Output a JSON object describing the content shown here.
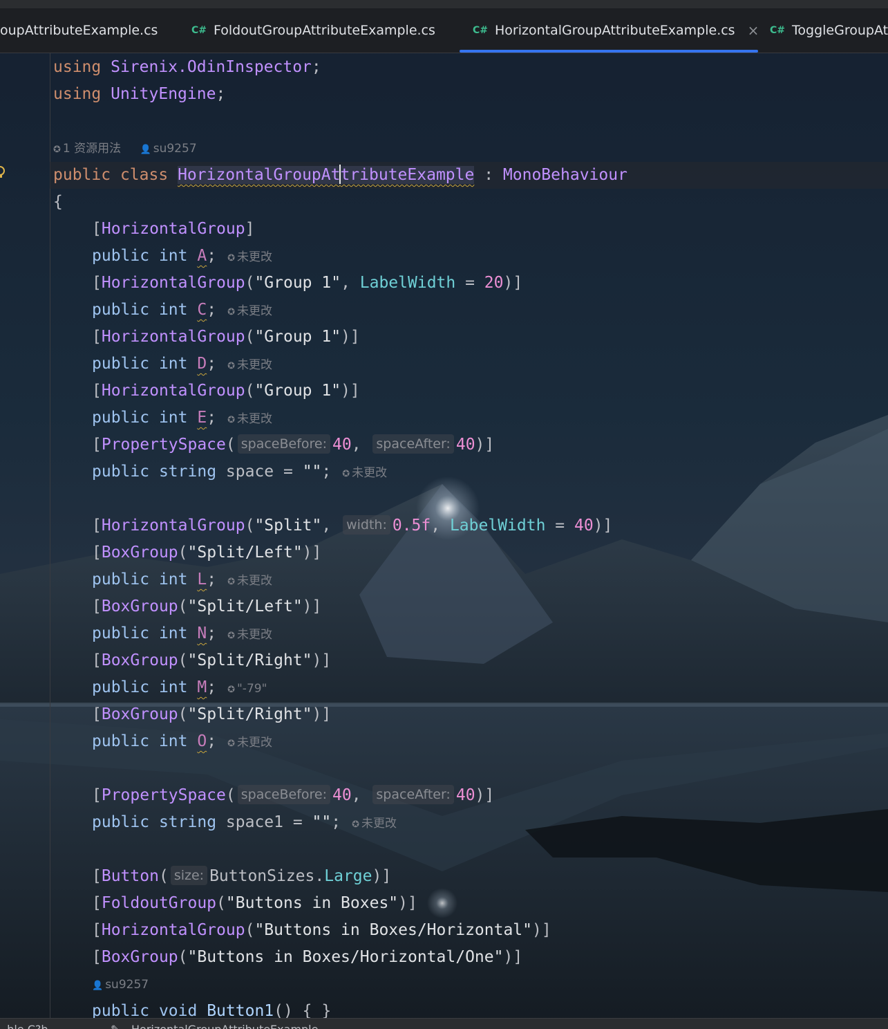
{
  "tabs": [
    {
      "label": "GroupAttributeExample.cs",
      "display": "oupAttributeExample.cs",
      "active": false
    },
    {
      "label": "FoldoutGroupAttributeExample.cs",
      "active": false
    },
    {
      "label": "HorizontalGroupAttributeExample.cs",
      "active": true
    },
    {
      "label": "ToggleGroupAt",
      "active": false
    }
  ],
  "tab_lang_badge": "C#",
  "tab_close_glyph": "×",
  "lens": {
    "usages": "1 资源用法",
    "author": "su9257",
    "unchanged": "未更改",
    "value_m": "\"-79\""
  },
  "code": {
    "using": "using",
    "ns1": "Sirenix.OdinInspector",
    "ns2": "UnityEngine",
    "public": "public",
    "class": "class",
    "int": "int",
    "string": "string",
    "void": "void",
    "class_name_a": "HorizontalGroupAt",
    "class_name_b": "tributeExample",
    "base": "MonoBehaviour",
    "open_brace": "{",
    "horizontal_group": "HorizontalGroup",
    "box_group": "BoxGroup",
    "property_space": "PropertySpace",
    "button": "Button",
    "foldout_group": "FoldoutGroup",
    "group1": "\"Group 1\"",
    "label_width": "LabelWidth",
    "split": "\"Split\"",
    "split_left": "\"Split/Left\"",
    "split_right": "\"Split/Right\"",
    "hint_space_before": "spaceBefore:",
    "hint_space_after": "spaceAfter:",
    "hint_width": "width:",
    "hint_size": "size:",
    "n20": "20",
    "n40": "40",
    "n05": "0.5f",
    "empty_str": "\"\"",
    "button_sizes": "ButtonSizes",
    "large": "Large",
    "buttons_in_boxes": "\"Buttons in Boxes\"",
    "buttons_horizontal": "\"Buttons in Boxes/Horizontal\"",
    "buttons_horizontal_one": "\"Buttons in Boxes/Horizontal/One\"",
    "fields": [
      "A",
      "C",
      "D",
      "E",
      "L",
      "N",
      "M",
      "O"
    ],
    "space": "space",
    "space1": "space1",
    "method": "Button1",
    "method_tail": "() { }"
  },
  "status": {
    "left": "..ble C?b",
    "file": "HorizontalGroupAttributeExample"
  }
}
